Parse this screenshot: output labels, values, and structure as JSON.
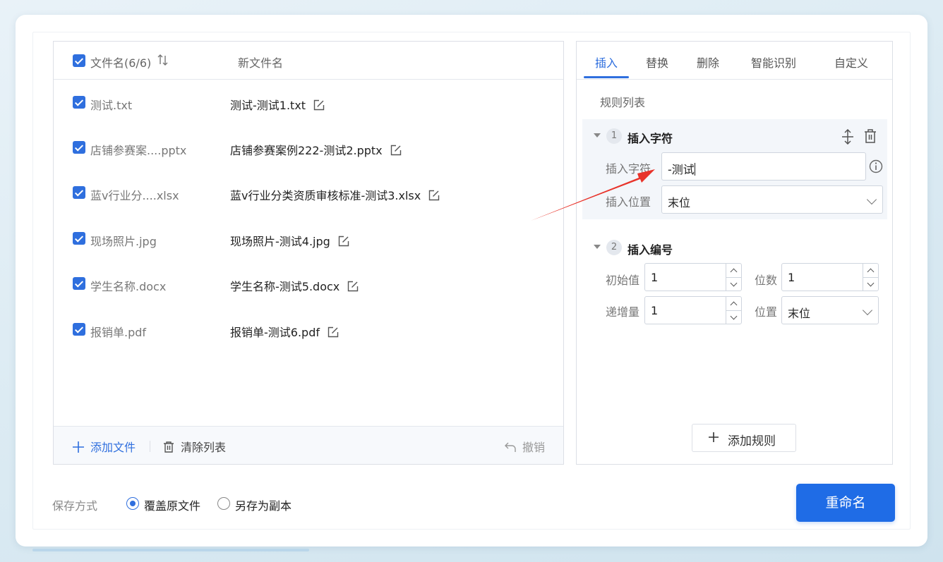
{
  "file_list": {
    "header": {
      "original_name_label": "文件名(6/6)",
      "new_name_label": "新文件名"
    },
    "files": [
      {
        "checked": true,
        "original": "测试.txt",
        "new": "测试-测试1.txt"
      },
      {
        "checked": true,
        "original": "店铺参赛案....pptx",
        "new": "店铺参赛案例222-测试2.pptx"
      },
      {
        "checked": true,
        "original": "蓝v行业分....xlsx",
        "new": "蓝v行业分类资质审核标准-测试3.xlsx"
      },
      {
        "checked": true,
        "original": "现场照片.jpg",
        "new": "现场照片-测试4.jpg"
      },
      {
        "checked": true,
        "original": "学生名称.docx",
        "new": "学生名称-测试5.docx"
      },
      {
        "checked": true,
        "original": "报销单.pdf",
        "new": "报销单-测试6.pdf"
      }
    ],
    "footer": {
      "add_files": "添加文件",
      "clear_list": "清除列表",
      "undo": "撤销"
    }
  },
  "rules_panel": {
    "tabs": [
      "插入",
      "替换",
      "删除",
      "智能识别",
      "自定义"
    ],
    "active_tab": "插入",
    "rule_list_title": "规则列表",
    "rule1": {
      "index": "1",
      "title": "插入字符",
      "insert_char_label": "插入字符",
      "insert_char_value": "-测试",
      "position_label": "插入位置",
      "position_value": "末位"
    },
    "rule2": {
      "index": "2",
      "title": "插入编号",
      "start_label": "初始值",
      "start_value": "1",
      "digits_label": "位数",
      "digits_value": "1",
      "step_label": "递增量",
      "step_value": "1",
      "position_label": "位置",
      "position_value": "末位"
    },
    "add_rule": "添加规则"
  },
  "save_mode": {
    "label": "保存方式",
    "options": [
      {
        "label": "覆盖原文件",
        "selected": true
      },
      {
        "label": "另存为副本",
        "selected": false
      }
    ]
  },
  "rename_button": "重命名",
  "colors": {
    "accent": "#2f6fde",
    "primary_button": "#1f6ce6",
    "annotation_arrow": "#e8332a"
  }
}
